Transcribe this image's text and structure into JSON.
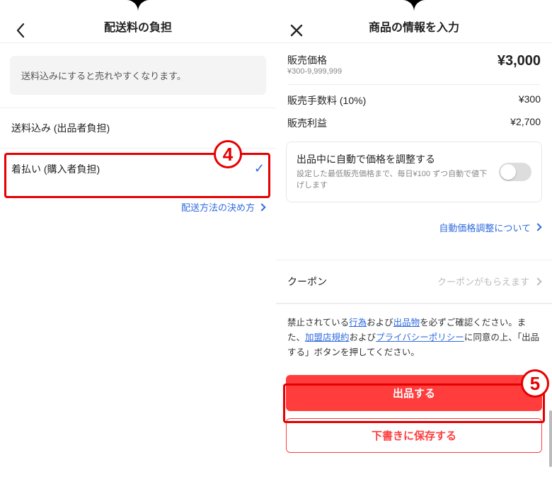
{
  "left": {
    "header_title": "配送料の負担",
    "notice": "送料込みにすると売れやすくなります。",
    "options": [
      {
        "label": "送料込み (出品者負担)",
        "selected": false
      },
      {
        "label": "着払い (購入者負担)",
        "selected": true
      }
    ],
    "help_link": "配送方法の決め方"
  },
  "right": {
    "header_title": "商品の情報を入力",
    "price": {
      "label": "販売価格",
      "range": "¥300-9,999,999",
      "value": "¥3,000"
    },
    "fee": {
      "label": "販売手数料 (10%)",
      "value": "¥300"
    },
    "profit": {
      "label": "販売利益",
      "value": "¥2,700"
    },
    "auto_adjust": {
      "title": "出品中に自動で価格を調整する",
      "desc": "設定した最低販売価格まで、毎日¥100 ずつ自動で値下げします",
      "enabled": false
    },
    "auto_link": "自動価格調整について",
    "coupon": {
      "label": "クーポン",
      "hint": "クーポンがもらえます"
    },
    "terms": {
      "t1": "禁止されている",
      "l1": "行為",
      "t2": "および",
      "l2": "出品物",
      "t3": "を必ずご確認ください。また、",
      "l3": "加盟店規約",
      "t4": "および",
      "l4": "プライバシーポリシー",
      "t5": "に同意の上、「出品する」ボタンを押してください。"
    },
    "primary_btn": "出品する",
    "secondary_btn": "下書きに保存する"
  },
  "annotations": {
    "a4": "4",
    "a5": "5"
  }
}
